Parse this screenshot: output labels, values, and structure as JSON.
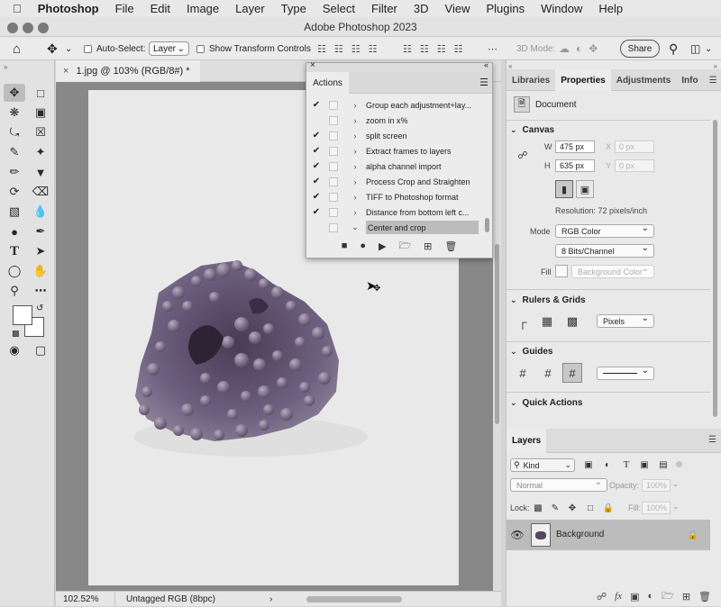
{
  "menubar": {
    "items": [
      "Photoshop",
      "File",
      "Edit",
      "Image",
      "Layer",
      "Type",
      "Select",
      "Filter",
      "3D",
      "View",
      "Plugins",
      "Window",
      "Help"
    ]
  },
  "window_title": "Adobe Photoshop 2023",
  "options_bar": {
    "auto_select_label": "Auto-Select:",
    "layer_select": "Layer",
    "transform_label": "Show Transform Controls",
    "mode_3d": "3D Mode:",
    "share": "Share"
  },
  "document_tab": "1.jpg @ 103% (RGB/8#) *",
  "status": {
    "zoom": "102.52%",
    "profile": "Untagged RGB (8bpc)"
  },
  "actions_panel": {
    "title": "Actions",
    "items": [
      {
        "name": "Group each adjustment+lay...",
        "checked": true,
        "expanded": false
      },
      {
        "name": "zoom in x%",
        "checked": false,
        "expanded": false
      },
      {
        "name": "split screen",
        "checked": true,
        "expanded": false
      },
      {
        "name": "Extract frames to layers",
        "checked": true,
        "expanded": false
      },
      {
        "name": "alpha channel import",
        "checked": true,
        "expanded": false
      },
      {
        "name": "Process Crop and Straighten",
        "checked": true,
        "expanded": false
      },
      {
        "name": "TIFF to Photoshop format",
        "checked": true,
        "expanded": false
      },
      {
        "name": "Distance from bottom left c...",
        "checked": true,
        "expanded": false
      },
      {
        "name": "Center and crop",
        "checked": false,
        "expanded": true
      }
    ]
  },
  "right_panel": {
    "tabs": [
      "Libraries",
      "Properties",
      "Adjustments",
      "Info"
    ],
    "active_tab": "Properties",
    "doc_label": "Document",
    "canvas": {
      "title": "Canvas",
      "w_label": "W",
      "w_value": "475 px",
      "h_label": "H",
      "h_value": "635 px",
      "x_label": "X",
      "x_value": "0 px",
      "y_label": "Y",
      "y_value": "0 px",
      "resolution": "Resolution: 72 pixels/inch",
      "mode_label": "Mode",
      "mode_value": "RGB Color",
      "bits_value": "8 Bits/Channel",
      "fill_label": "Fill",
      "fill_value": "Background Color"
    },
    "rulers": {
      "title": "Rulers & Grids",
      "units": "Pixels"
    },
    "guides": {
      "title": "Guides"
    },
    "quick_actions": {
      "title": "Quick Actions"
    }
  },
  "layers_panel": {
    "title": "Layers",
    "kind": "Kind",
    "blend": "Normal",
    "opacity_label": "Opacity:",
    "opacity": "100%",
    "lock_label": "Lock:",
    "fill_label": "Fill:",
    "fill": "100%",
    "layers": [
      {
        "name": "Background",
        "visible": true,
        "locked": true
      }
    ]
  },
  "colors": {
    "accent": "#8f8f8f",
    "canvas_bg": "#888888",
    "selected_row": "#bcbcbc"
  }
}
